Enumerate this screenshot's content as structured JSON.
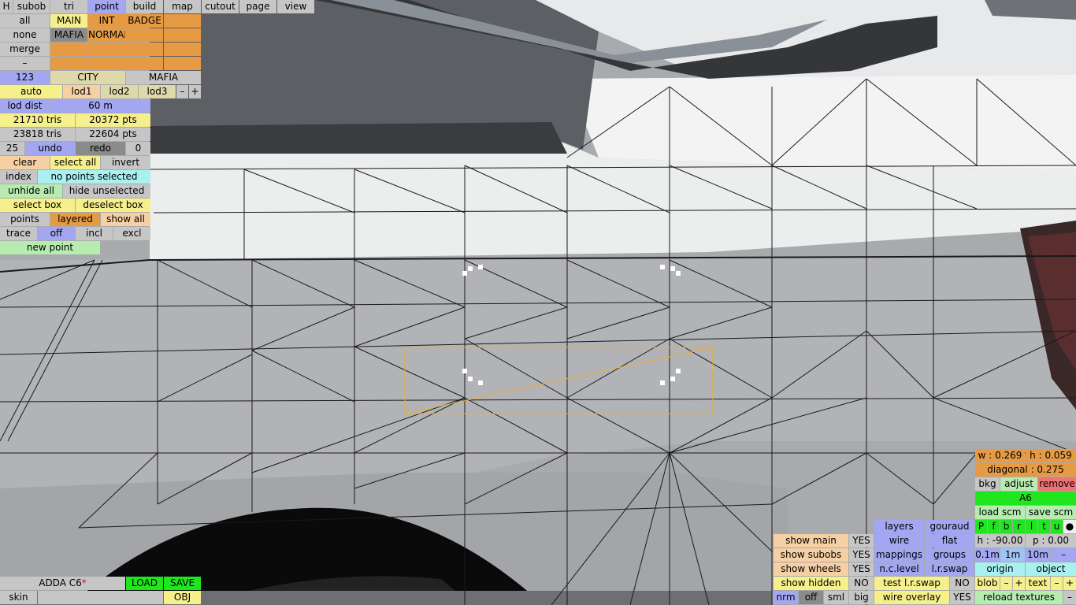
{
  "colors": {
    "gray": "#c6c6c6",
    "orange": "#e59a43",
    "blue": "#a3a7f2",
    "yellow": "#f5f08b",
    "lightgreen": "#b6ecb0",
    "cyan": "#a9f0f1",
    "darkgray": "#8b8b8b",
    "green": "#1fe61f",
    "red": "#ef7373",
    "selection": "#f2ae2e",
    "mesh": "#1a1a1a"
  },
  "topbar": {
    "h": "H",
    "subob": "subob",
    "tri": "tri",
    "point": "point",
    "build": "build",
    "map": "map",
    "cutout": "cutout",
    "page": "page",
    "view": "view"
  },
  "left": {
    "all": "all",
    "main": "MAIN",
    "int": "INT",
    "badge": "BADGE",
    "none": "none",
    "mafia": "MAFIA",
    "normal": "NORMAL",
    "merge": "merge",
    "dash": "–",
    "num123": "123",
    "city": "CITY",
    "mafia2": "MAFIA",
    "auto": "auto",
    "lod1": "lod1",
    "lod2": "lod2",
    "lod3": "lod3",
    "minus": "–",
    "plus": "+",
    "lod_dist_label": "lod dist",
    "lod_dist_value": "60 m",
    "tris1": "21710 tris",
    "pts1": "20372 pts",
    "tris2": "23818 tris",
    "pts2": "22604 pts",
    "undo_count": "25",
    "undo": "undo",
    "redo": "redo",
    "redo_count": "0",
    "clear": "clear",
    "select_all": "select all",
    "invert": "invert",
    "index": "index",
    "selection_status": "no points selected",
    "unhide_all": "unhide all",
    "hide_unselected": "hide unselected",
    "select_box": "select box",
    "deselect_box": "deselect box",
    "points": "points",
    "layered": "layered",
    "show_all": "show all",
    "trace": "trace",
    "off": "off",
    "incl": "incl",
    "excl": "excl",
    "new_point": "new point"
  },
  "bottom_left": {
    "model_name": "ADDA C6",
    "modified_mark": "*",
    "load": "LOAD",
    "save": "SAVE",
    "skin": "skin",
    "obj": "OBJ"
  },
  "bottom_mid": {
    "show_main": "show main",
    "show_main_val": "YES",
    "show_subobs": "show subobs",
    "show_subobs_val": "YES",
    "show_wheels": "show wheels",
    "show_wheels_val": "YES",
    "show_hidden": "show hidden",
    "show_hidden_val": "NO",
    "nrm": "nrm",
    "off": "off",
    "sml": "sml",
    "big": "big",
    "layers": "layers",
    "gouraud": "gouraud",
    "wire": "wire",
    "flat": "flat",
    "mappings": "mappings",
    "groups": "groups",
    "nclevel": "n.c.level",
    "lrswap": "l.r.swap",
    "test_lrswap": "test l.r.swap",
    "test_lrswap_val": "NO",
    "wire_overlay": "wire overlay",
    "wire_overlay_val": "YES"
  },
  "bottom_right": {
    "w": "w : 0.269",
    "h": "h : 0.059",
    "diagonal": "diagonal : 0.275",
    "bkg": "bkg",
    "adjust": "adjust",
    "remove": "remove",
    "a6": "A6",
    "load_scm": "load scm",
    "save_scm": "save scm",
    "channels": [
      "P",
      "f",
      "b",
      "r",
      "l",
      "t",
      "u",
      "●"
    ],
    "heading": "h : -90.00",
    "pitch": "p : 0.00",
    "step01": "0.1m",
    "step1": "1m",
    "step10": "10m",
    "step_minus": "–",
    "origin": "origin",
    "object": "object",
    "blob": "blob",
    "blob_minus": "–",
    "blob_plus": "+",
    "text": "text",
    "text_minus": "–",
    "text_plus": "+",
    "reload_textures": "reload textures",
    "reload_minus": "–"
  }
}
